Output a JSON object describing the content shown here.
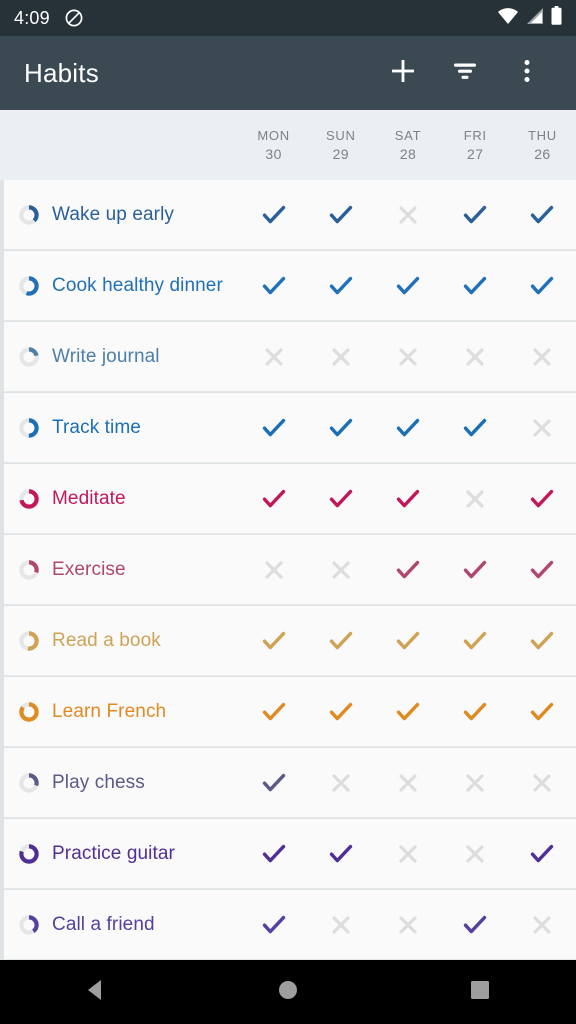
{
  "status_bar": {
    "time": "4:09",
    "icons": [
      "do-not-disturb-icon",
      "wifi-icon",
      "cellular-signal-icon",
      "battery-icon"
    ]
  },
  "app_bar": {
    "title": "Habits",
    "actions": [
      {
        "name": "add-habit-button",
        "icon": "plus-icon",
        "label": "Add habit"
      },
      {
        "name": "filter-button",
        "icon": "filter-icon",
        "label": "Filter"
      },
      {
        "name": "overflow-menu-button",
        "icon": "more-vertical-icon",
        "label": "More options"
      }
    ]
  },
  "table": {
    "columns": [
      {
        "dow": "MON",
        "dom": "30"
      },
      {
        "dow": "SUN",
        "dom": "29"
      },
      {
        "dow": "SAT",
        "dom": "28"
      },
      {
        "dow": "FRI",
        "dom": "27"
      },
      {
        "dow": "THU",
        "dom": "26"
      }
    ],
    "check_symbol": "check",
    "cross_symbol": "cross",
    "unchecked_color": "#dddddd",
    "rows": [
      {
        "name": "Wake up early",
        "color": "#2a6099",
        "ring": 0.38,
        "checks": [
          true,
          true,
          false,
          true,
          true
        ]
      },
      {
        "name": "Cook healthy dinner",
        "color": "#2170b8",
        "ring": 0.55,
        "checks": [
          true,
          true,
          true,
          true,
          true
        ]
      },
      {
        "name": "Write journal",
        "color": "#4e7fa8",
        "ring": 0.22,
        "checks": [
          false,
          false,
          false,
          false,
          false
        ]
      },
      {
        "name": "Track time",
        "color": "#1a6fb5",
        "ring": 0.5,
        "checks": [
          true,
          true,
          true,
          true,
          false
        ]
      },
      {
        "name": "Meditate",
        "color": "#c2185b",
        "ring": 0.72,
        "checks": [
          true,
          true,
          true,
          false,
          true
        ]
      },
      {
        "name": "Exercise",
        "color": "#b1476e",
        "ring": 0.3,
        "checks": [
          false,
          false,
          true,
          true,
          true
        ]
      },
      {
        "name": "Read a book",
        "color": "#cfa255",
        "ring": 0.52,
        "checks": [
          true,
          true,
          true,
          true,
          true
        ]
      },
      {
        "name": "Learn French",
        "color": "#e08a22",
        "ring": 0.85,
        "checks": [
          true,
          true,
          true,
          true,
          true
        ]
      },
      {
        "name": "Play chess",
        "color": "#5c5a86",
        "ring": 0.3,
        "checks": [
          true,
          false,
          false,
          false,
          false
        ]
      },
      {
        "name": "Practice guitar",
        "color": "#4f2f96",
        "ring": 0.8,
        "checks": [
          true,
          true,
          false,
          false,
          true
        ]
      },
      {
        "name": "Call a friend",
        "color": "#553fa0",
        "ring": 0.4,
        "checks": [
          true,
          false,
          false,
          true,
          false
        ]
      }
    ]
  },
  "nav_bar": {
    "buttons": [
      {
        "name": "back-button",
        "icon": "triangle-back-icon"
      },
      {
        "name": "home-button",
        "icon": "circle-home-icon"
      },
      {
        "name": "recents-button",
        "icon": "square-recents-icon"
      }
    ]
  },
  "theme": {
    "status_bar_bg": "#263238",
    "app_bar_bg": "#3b4a52",
    "page_bg": "#eceff1",
    "row_bg": "#fafafa",
    "header_text": "#78838a",
    "nav_bar_bg": "#000000"
  }
}
